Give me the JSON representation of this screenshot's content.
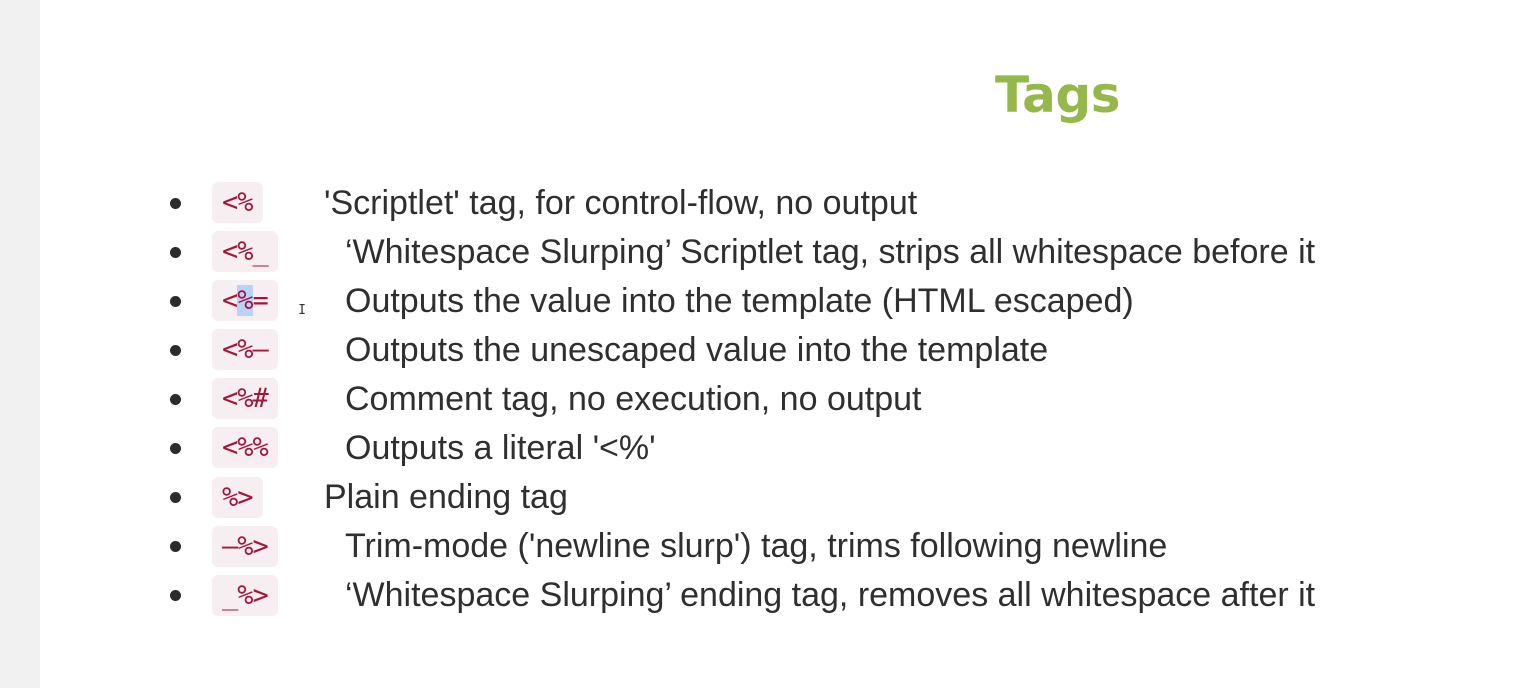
{
  "slide": {
    "title": "Tags",
    "colors": {
      "title": "#94b94a",
      "code_text": "#a3163a",
      "code_bg": "#f6eef0",
      "body_text": "#2f2f2f",
      "selection": "#b8d3f7"
    },
    "items": [
      {
        "code": "<%",
        "description": "'Scriptlet' tag, for control-flow, no output"
      },
      {
        "code": "<%_",
        "description": "‘Whitespace Slurping’ Scriptlet tag, strips all whitespace before it"
      },
      {
        "code_parts": [
          "<",
          "%",
          "="
        ],
        "description": "Outputs the value into the template (HTML escaped)"
      },
      {
        "code": "<%–",
        "description": "Outputs the unescaped value into the template"
      },
      {
        "code": "<%#",
        "description": "Comment tag, no execution, no output"
      },
      {
        "code": "<%%",
        "description": "Outputs a literal '<%'"
      },
      {
        "code": "%>",
        "description": "Plain ending tag"
      },
      {
        "code": "–%>",
        "description": "Trim-mode ('newline slurp') tag, trims following newline"
      },
      {
        "code": "_%>",
        "description": "‘Whitespace Slurping’ ending tag, removes all whitespace after it"
      }
    ],
    "cursor_icon": "text-cursor-icon"
  }
}
